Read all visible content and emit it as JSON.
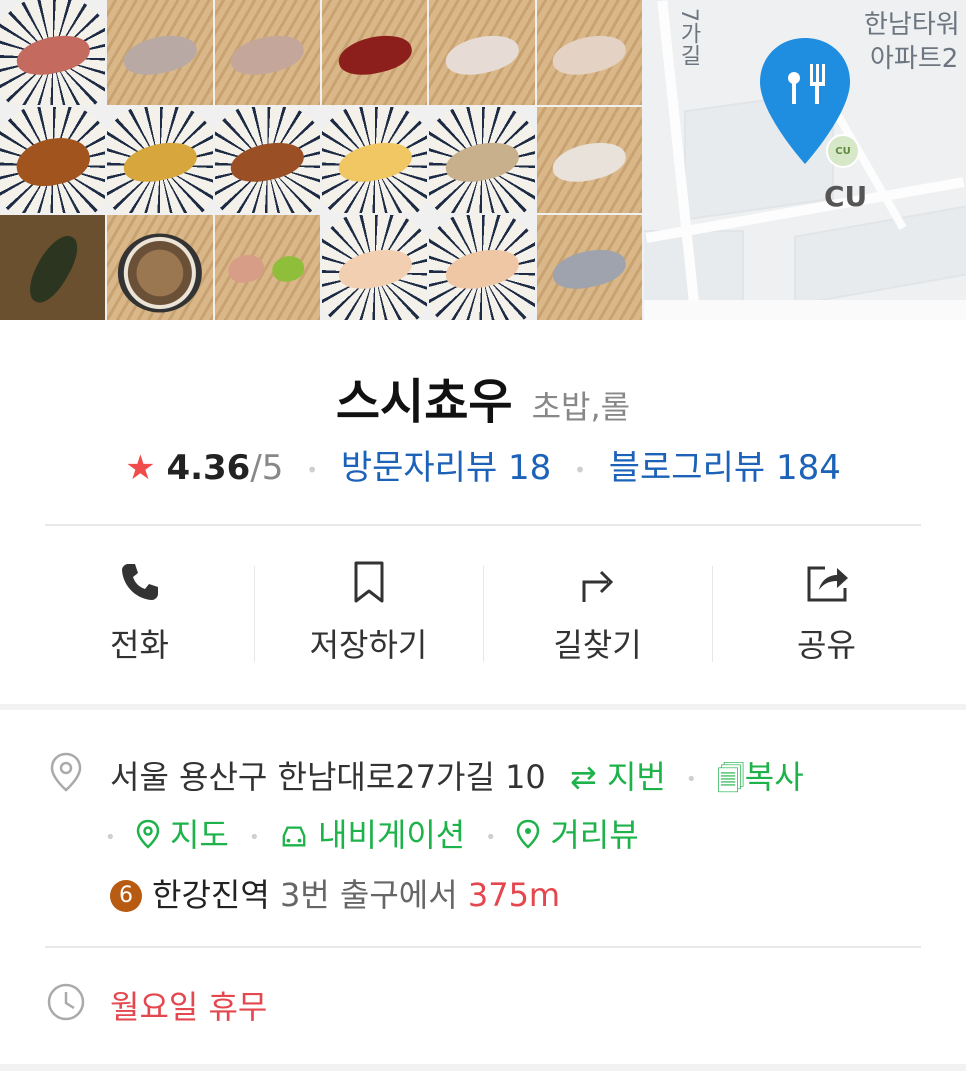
{
  "place": {
    "name": "스시쵸우",
    "category": "초밥,롤",
    "rating": "4.36",
    "rating_max": "/5",
    "visitor_review_label": "방문자리뷰 18",
    "blog_review_label": "블로그리뷰 184"
  },
  "map": {
    "labels": [
      "한남타워",
      "아파트2",
      "7가길"
    ],
    "cu_label": "CU",
    "cu_badge": "CU"
  },
  "actions": [
    {
      "label": "전화",
      "icon": "phone-icon"
    },
    {
      "label": "저장하기",
      "icon": "bookmark-icon"
    },
    {
      "label": "길찾기",
      "icon": "directions-icon"
    },
    {
      "label": "공유",
      "icon": "share-icon"
    }
  ],
  "address": {
    "text": "서울 용산구 한남대로27가길 10",
    "jibun_label": "⇄ 지번",
    "copy_label": "복사",
    "map_label": "지도",
    "navi_label": "내비게이션",
    "street_label": "거리뷰"
  },
  "transit": {
    "line_number": "6",
    "station": "한강진역",
    "exit_text": "3번 출구에서",
    "distance": "375m"
  },
  "hours": {
    "closed_text": "월요일 휴무"
  },
  "colors": {
    "link_blue": "#1b62b8",
    "action_green": "#1eb24a",
    "alert_red": "#e4474d",
    "star_red": "#f04c4c",
    "line6_brown": "#b85b12",
    "pin_blue": "#1f8de0"
  }
}
